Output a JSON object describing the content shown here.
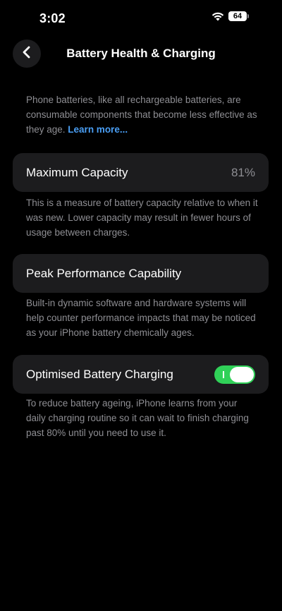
{
  "status_bar": {
    "time": "3:02",
    "battery_level": "64",
    "icons": [
      "wifi-icon",
      "battery-icon"
    ]
  },
  "nav": {
    "title": "Battery Health & Charging",
    "back_icon": "chevron-left-icon"
  },
  "intro": {
    "text": "Phone batteries, like all rechargeable batteries, are consumable components that become less effective as they age. ",
    "link": "Learn more..."
  },
  "maximum_capacity": {
    "label": "Maximum Capacity",
    "value": "81%",
    "description": "This is a measure of battery capacity relative to when it was new. Lower capacity may result in fewer hours of usage between charges."
  },
  "peak_performance": {
    "label": "Peak Performance Capability",
    "description": "Built-in dynamic software and hardware systems will help counter performance impacts that may be noticed as your iPhone battery chemically ages."
  },
  "optimised_charging": {
    "label": "Optimised Battery Charging",
    "enabled": true,
    "description": "To reduce battery ageing, iPhone learns from your daily charging routine so it can wait to finish charging past 80% until you need to use it."
  },
  "colors": {
    "background": "#000000",
    "card": "#1c1c1e",
    "secondary_text": "#8e8e93",
    "link": "#4a9ff5",
    "toggle_on": "#30d158"
  }
}
